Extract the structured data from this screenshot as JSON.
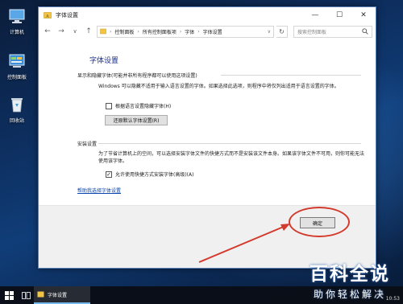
{
  "desktop": {
    "icons": [
      {
        "label": "计算机",
        "icon": "computer-icon"
      },
      {
        "label": "控制面板",
        "icon": "control-panel-icon"
      },
      {
        "label": "回收站",
        "icon": "recycle-bin-icon"
      }
    ]
  },
  "window": {
    "title": "字体设置",
    "controls": {
      "minimize": "—",
      "maximize": "☐",
      "close": "✕"
    }
  },
  "navbar": {
    "back": "←",
    "forward": "→",
    "up": "↑",
    "breadcrumb": [
      "控制面板",
      "所有控制面板项",
      "字体",
      "字体设置"
    ],
    "breadcrumb_sep": "›",
    "dropdown": "∨",
    "refresh": "↻",
    "search_placeholder": "搜索控制面板",
    "search_icon": "search-icon"
  },
  "page": {
    "title": "字体设置",
    "group1": {
      "heading": "显示和隐藏字体(可能并非所有程序都可以使用这项设置)",
      "description": "Windows 可以隐藏不适用于输入语言设置的字体。如果选择此选项，则程序中将仅列出适用于语言设置的字体。",
      "checkbox_label": "根据语言设置隐藏字体(H)",
      "checkbox_checked": false,
      "button_label": "还原默认字体设置(R)"
    },
    "group2": {
      "heading": "安装设置",
      "description": "为了节省计算机上的空间，可以选择安装字体文件的快捷方式而不是安装该文件本身。如果该字体文件不可用，则你可能无法使用该字体。",
      "checkbox_label": "允许使用快捷方式安装字体(高级)(A)",
      "checkbox_checked": true
    },
    "help_link": "帮助我选择字体设置",
    "ok_button": "确定"
  },
  "annotation": {
    "color": "#d33a2c"
  },
  "taskbar": {
    "start_icon": "windows-start-icon",
    "taskview_icon": "task-view-icon",
    "active_app": "字体设置",
    "clock": "10:53"
  },
  "watermark": {
    "main": "百科全说",
    "sub": "助你轻松解决"
  },
  "colors": {
    "accent": "#1e3287",
    "link": "#0645ad",
    "taskbar_highlight": "#76b9ed"
  }
}
